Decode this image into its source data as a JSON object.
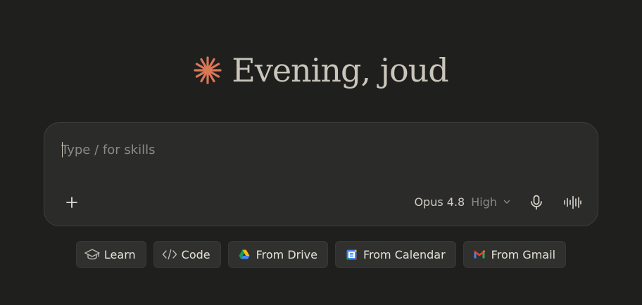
{
  "greeting": {
    "text": "Evening, joud",
    "logo_icon": "spark-asterisk-icon",
    "logo_color": "#d97757"
  },
  "composer": {
    "placeholder": "Type / for skills",
    "value": "",
    "add_icon": "plus-icon",
    "model": {
      "name": "Opus 4.8",
      "effort": "High",
      "dropdown_icon": "chevron-down-icon"
    },
    "mic_icon": "microphone-icon",
    "voice_icon": "voice-waveform-icon"
  },
  "chips": [
    {
      "label": "Learn",
      "icon": "graduation-cap-icon"
    },
    {
      "label": "Code",
      "icon": "code-brackets-icon"
    },
    {
      "label": "From Drive",
      "icon": "google-drive-icon"
    },
    {
      "label": "From Calendar",
      "icon": "google-calendar-icon"
    },
    {
      "label": "From Gmail",
      "icon": "gmail-icon"
    }
  ],
  "colors": {
    "background": "#1f1f1e",
    "composer_bg": "#2b2b29",
    "chip_bg": "#30302e",
    "accent": "#d97757"
  }
}
